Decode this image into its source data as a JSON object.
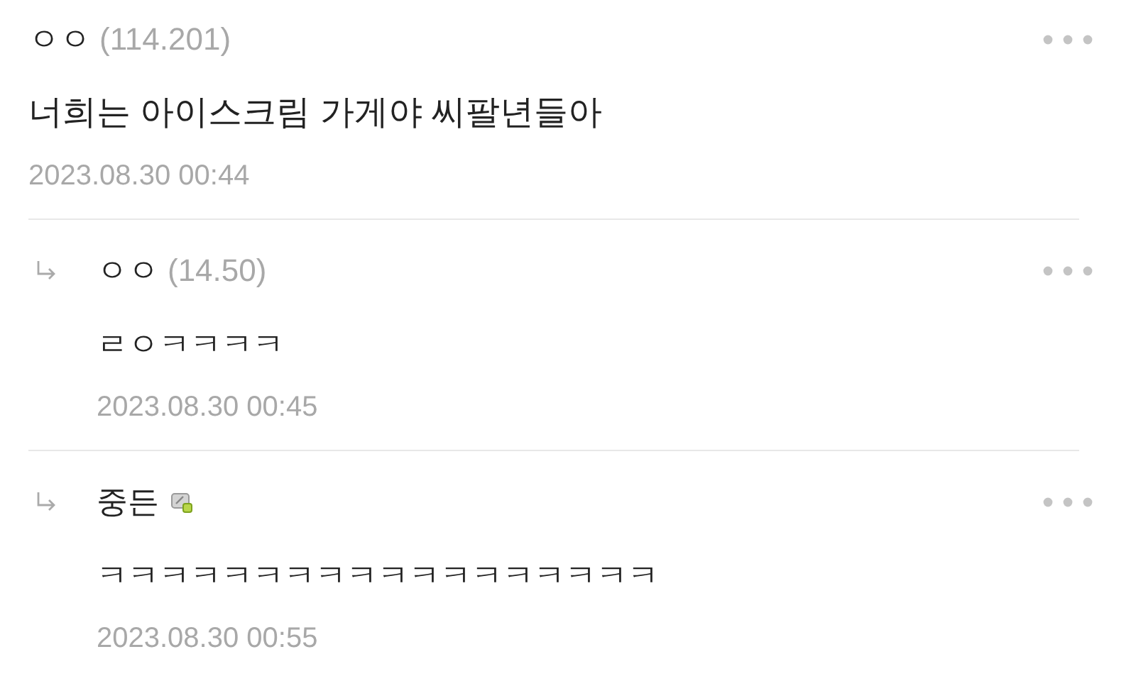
{
  "comments": [
    {
      "author": "ㅇㅇ",
      "ip": "(114.201)",
      "badge": false,
      "text": "너희는 아이스크림 가게야 씨팔년들아",
      "date": "2023.08.30 00:44",
      "replies": [
        {
          "author": "ㅇㅇ",
          "ip": "(14.50)",
          "badge": false,
          "text": "ㄹㅇㅋㅋㅋㅋ",
          "date": "2023.08.30 00:45"
        },
        {
          "author": "중든",
          "badge": true,
          "text": "ㅋㅋㅋㅋㅋㅋㅋㅋㅋㅋㅋㅋㅋㅋㅋㅋㅋㅋ",
          "date": "2023.08.30 00:55"
        }
      ]
    }
  ]
}
